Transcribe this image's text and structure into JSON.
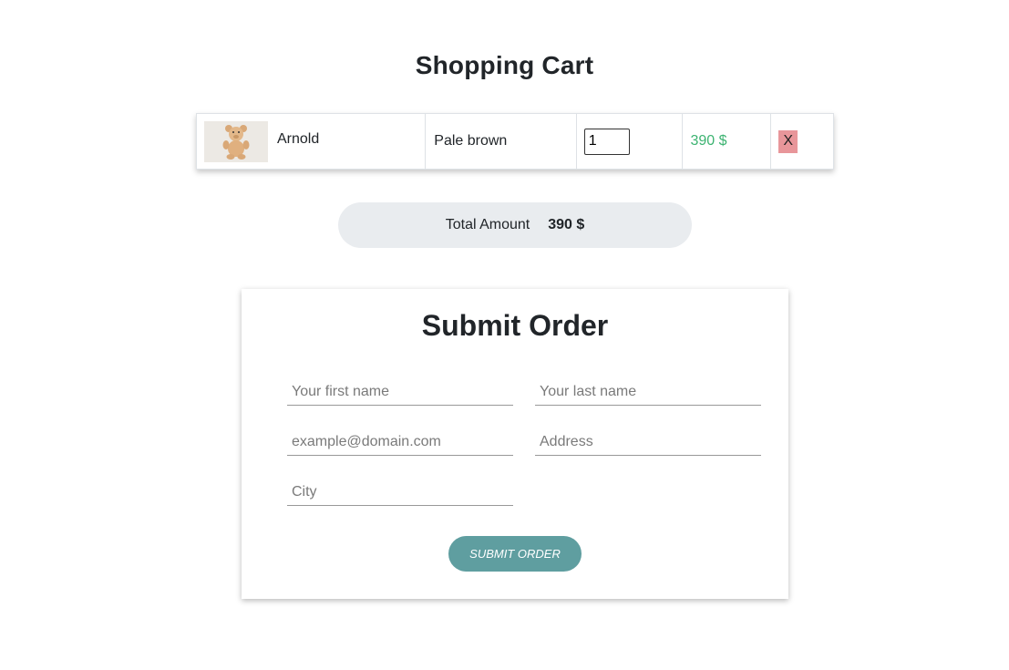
{
  "cart": {
    "title": "Shopping Cart",
    "items": [
      {
        "name": "Arnold",
        "color": "Pale brown",
        "quantity": "1",
        "price": "390 $",
        "remove_label": "X",
        "image_icon": "teddy-bear-image"
      }
    ]
  },
  "total": {
    "label": "Total Amount",
    "value": "390 $"
  },
  "order_form": {
    "title": "Submit Order",
    "first_name_placeholder": "Your first name",
    "last_name_placeholder": "Your last name",
    "email_placeholder": "example@domain.com",
    "address_placeholder": "Address",
    "city_placeholder": "City",
    "submit_label": "Submit Order"
  },
  "colors": {
    "price": "#3cb371",
    "remove_button": "#e8969a",
    "submit_button": "#5f9ea0",
    "total_background": "#e9ecef"
  }
}
